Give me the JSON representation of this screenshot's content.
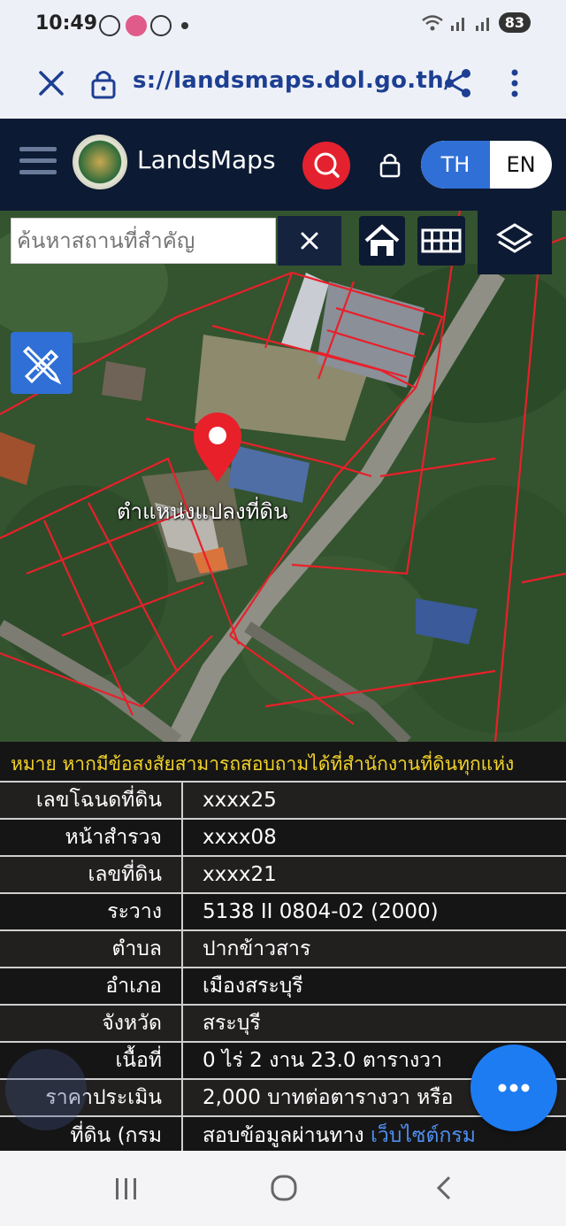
{
  "status_bar": {
    "time": "10:49",
    "battery": "83",
    "apps": [
      "line-app-icon",
      "badge-app-icon",
      "smiley-app-icon"
    ]
  },
  "browser": {
    "url": "s://landsmaps.dol.go.th/"
  },
  "app_header": {
    "brand": "LandsMaps",
    "lang_th": "TH",
    "lang_en": "EN",
    "colors": {
      "header_bg": "#0c1a33",
      "accent_blue": "#2f6fd6",
      "search_red": "#e4212e"
    }
  },
  "map": {
    "search_placeholder": "ค้นหาสถานที่สำคัญ",
    "marker_label": "ตำแหน่งแปลงที่ดิน",
    "parcel_line_color": "#e8202a"
  },
  "info": {
    "notice": "หมาย หากมีข้อสงสัยสามารถสอบถามได้ที่สำนักงานที่ดินทุกแห่ง",
    "rows": [
      {
        "label": "เลขโฉนดที่ดิน",
        "value": "xxxx25"
      },
      {
        "label": "หน้าสำรวจ",
        "value": "xxxx08"
      },
      {
        "label": "เลขที่ดิน",
        "value": "xxxx21"
      },
      {
        "label": "ระวาง",
        "value": "5138 II 0804-02 (2000)"
      },
      {
        "label": "ตำบล",
        "value": "ปากข้าวสาร"
      },
      {
        "label": "อำเภอ",
        "value": "เมืองสระบุรี"
      },
      {
        "label": "จังหวัด",
        "value": "สระบุรี"
      },
      {
        "label": "เนื้อที่",
        "value": "0 ไร่ 2 งาน 23.0 ตารางวา"
      },
      {
        "label": "ราคาประเมิน",
        "value": "2,000 บาทต่อตารางวา หรือ"
      },
      {
        "label": "ที่ดิน (กรม",
        "value": "สอบข้อมูลผ่านทาง",
        "link": "เว็บไซต์กรม"
      }
    ]
  }
}
